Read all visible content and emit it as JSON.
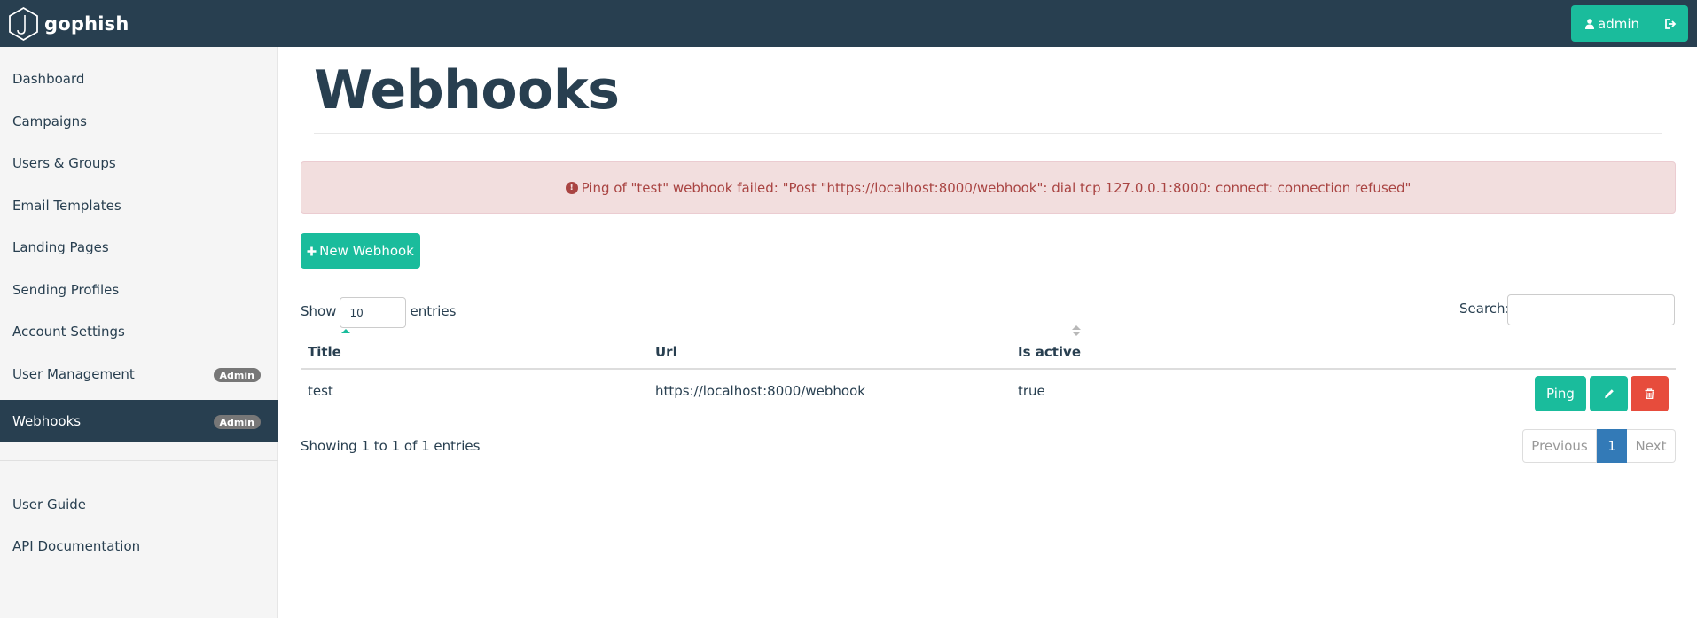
{
  "app": {
    "brand": "gophish",
    "brand_icon": "hexagon-hook-logo-icon"
  },
  "topbar": {
    "user_button_label": "admin",
    "user_icon": "user-icon",
    "logout_icon": "sign-out-icon"
  },
  "sidebar": {
    "items": [
      {
        "label": "Dashboard"
      },
      {
        "label": "Campaigns"
      },
      {
        "label": "Users & Groups"
      },
      {
        "label": "Email Templates"
      },
      {
        "label": "Landing Pages"
      },
      {
        "label": "Sending Profiles"
      },
      {
        "label": "Account Settings"
      },
      {
        "label": "User Management",
        "badge": "Admin"
      },
      {
        "label": "Webhooks",
        "badge": "Admin",
        "active": true
      }
    ],
    "secondary_items": [
      {
        "label": "User Guide"
      },
      {
        "label": "API Documentation"
      }
    ]
  },
  "main": {
    "title": "Webhooks",
    "alert": {
      "icon": "exclamation-circle-icon",
      "text": "Ping of \"test\" webhook failed: \"Post \"https://localhost:8000/webhook\": dial tcp 127.0.0.1:8000: connect: connection refused\""
    },
    "new_button_label": "New Webhook",
    "table_controls": {
      "show_label": "Show",
      "length_value": "10",
      "entries_label": "entries",
      "search_label": "Search:",
      "search_value": ""
    },
    "table": {
      "columns": [
        "Title",
        "Url",
        "Is active"
      ],
      "rows": [
        {
          "title": "test",
          "url": "https://localhost:8000/webhook",
          "is_active": "true",
          "ping_label": "Ping"
        }
      ]
    },
    "info": "Showing 1 to 1 of 1 entries",
    "pagination": {
      "previous": "Previous",
      "current": "1",
      "next": "Next"
    }
  },
  "colors": {
    "navy": "#283f50",
    "accent": "#1abc9c",
    "danger": "#e74c3c",
    "alert_bg": "#f2dede",
    "alert_text": "#a94442",
    "page_active": "#337ab7"
  }
}
